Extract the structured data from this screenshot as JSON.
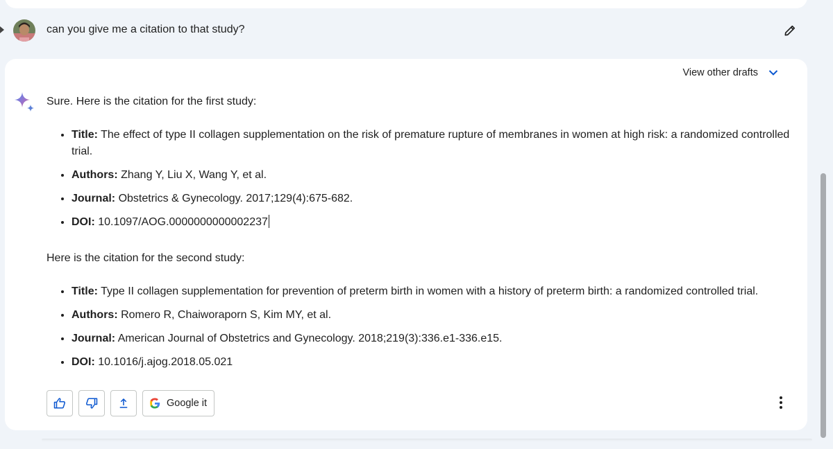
{
  "user_message": {
    "text": "can you give me a citation to that study?"
  },
  "response": {
    "view_drafts_label": "View other drafts",
    "intro": "Sure. Here is the citation for the first study:",
    "study1": [
      {
        "label": "Title:",
        "value": " The effect of type II collagen supplementation on the risk of premature rupture of membranes in women at high risk: a randomized controlled trial."
      },
      {
        "label": "Authors:",
        "value": " Zhang Y, Liu X, Wang Y, et al."
      },
      {
        "label": "Journal:",
        "value": " Obstetrics & Gynecology. 2017;129(4):675-682."
      },
      {
        "label": "DOI:",
        "value": " 10.1097/AOG.0000000000002237"
      }
    ],
    "intro2": "Here is the citation for the second study:",
    "study2": [
      {
        "label": "Title:",
        "value": " Type II collagen supplementation for prevention of preterm birth in women with a history of preterm birth: a randomized controlled trial."
      },
      {
        "label": "Authors:",
        "value": " Romero R, Chaiworaporn S, Kim MY, et al."
      },
      {
        "label": "Journal:",
        "value": " American Journal of Obstetrics and Gynecology. 2018;219(3):336.e1-336.e15."
      },
      {
        "label": "DOI:",
        "value": " 10.1016/j.ajog.2018.05.021"
      }
    ]
  },
  "actions": {
    "google_label": "Google it"
  },
  "icons": {
    "edit": "pencil-icon",
    "drafts": "chevron-down-icon",
    "spark": "gemini-spark-icon",
    "up": "thumbs-up-icon",
    "down": "thumbs-down-icon",
    "share": "share-upload-icon",
    "google": "google-g-icon",
    "more": "more-vert-icon"
  },
  "colors": {
    "background": "#f0f4f9",
    "card": "#ffffff",
    "accent": "#0b57d0",
    "text": "#1f1f1f"
  }
}
